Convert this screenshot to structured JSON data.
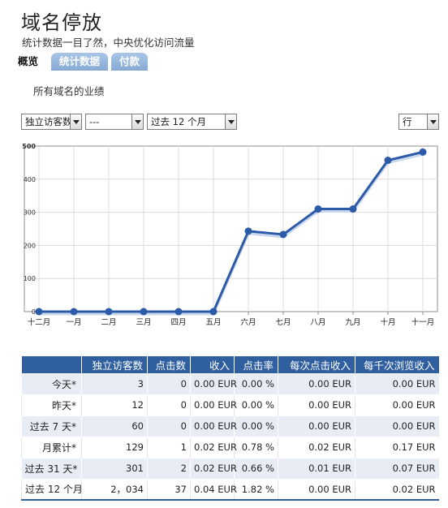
{
  "header": {
    "title": "域名停放",
    "subtitle": "统计数据一目了然，中央优化访问流量"
  },
  "tabs": [
    {
      "label": "概览"
    },
    {
      "label": "统计数据"
    },
    {
      "label": "付款"
    }
  ],
  "section_heading": "所有域名的业绩",
  "filters": {
    "metric": "独立访客数",
    "compare": "---",
    "period": "过去 12 个月",
    "granularity": "行"
  },
  "colors": {
    "accent": "#2f5f9f",
    "line": "#2a5aa8",
    "tab": "#86a9d4"
  },
  "chart_data": {
    "type": "line",
    "categories": [
      "十二月",
      "一月",
      "二月",
      "三月",
      "四月",
      "五月",
      "六月",
      "七月",
      "八月",
      "九月",
      "十月",
      "十一月"
    ],
    "values": [
      0,
      0,
      0,
      0,
      0,
      0,
      243,
      233,
      310,
      310,
      457,
      482
    ],
    "yticks": [
      "0",
      "100",
      "200",
      "300",
      "400",
      "500"
    ],
    "ylim": [
      0,
      500
    ],
    "grid": true
  },
  "table": {
    "headers": [
      "独立访客数",
      "点击数",
      "收入",
      "点击率",
      "每次点击收入",
      "每千次浏览收入"
    ],
    "rows": [
      {
        "label": "今天*",
        "cells": [
          "3",
          "0",
          "0.00 EUR",
          "0.00 %",
          "0.00 EUR",
          "0.00 EUR"
        ]
      },
      {
        "label": "昨天*",
        "cells": [
          "12",
          "0",
          "0.00 EUR",
          "0.00 %",
          "0.00 EUR",
          "0.00 EUR"
        ]
      },
      {
        "label": "过去 7 天*",
        "cells": [
          "60",
          "0",
          "0.00 EUR",
          "0.00 %",
          "0.00 EUR",
          "0.00 EUR"
        ]
      },
      {
        "label": "月累计*",
        "cells": [
          "129",
          "1",
          "0.02 EUR",
          "0.78 %",
          "0.02 EUR",
          "0.17 EUR"
        ]
      },
      {
        "label": "过去 31 天*",
        "cells": [
          "301",
          "2",
          "0.02 EUR",
          "0.66 %",
          "0.01 EUR",
          "0.07 EUR"
        ]
      },
      {
        "label": "过去 12 个月",
        "cells": [
          "2，034",
          "37",
          "0.04 EUR",
          "1.82 %",
          "0.00 EUR",
          "0.02 EUR"
        ]
      }
    ]
  }
}
